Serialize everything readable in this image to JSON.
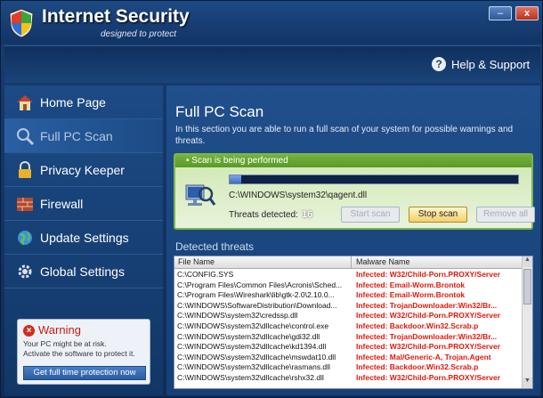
{
  "app": {
    "title": "Internet Security",
    "tagline": "designed to protect"
  },
  "window_controls": {
    "minimize": "–",
    "close": "x"
  },
  "helpbar": {
    "icon": "question-icon",
    "label": "Help & Support"
  },
  "sidebar": {
    "items": [
      {
        "label": "Home Page",
        "icon": "house-icon",
        "active": false
      },
      {
        "label": "Full PC Scan",
        "icon": "magnifier-icon",
        "active": true
      },
      {
        "label": "Privacy Keeper",
        "icon": "lock-icon",
        "active": false
      },
      {
        "label": "Firewall",
        "icon": "brick-wall-icon",
        "active": false
      },
      {
        "label": "Update Settings",
        "icon": "globe-icon",
        "active": false
      },
      {
        "label": "Global Settings",
        "icon": "gear-icon",
        "active": false
      }
    ],
    "warning": {
      "title": "Warning",
      "text": "Your PC might be at risk.\nActivate the software to protect it.",
      "button": "Get full time protection now"
    }
  },
  "main": {
    "title": "Full PC Scan",
    "description": "In this section you are able to run a full scan of your system for possible warnings and threats.",
    "scan": {
      "status": "Scan is being performed",
      "current_file": "C:\\WINDOWS\\system32\\qagent.dll",
      "progress": 0.04,
      "threats_label": "Threats detected:",
      "threats_count": "16",
      "buttons": {
        "start": "Start scan",
        "stop": "Stop scan",
        "remove": "Remove all"
      }
    },
    "detected_label": "Detected threats",
    "table": {
      "columns": [
        "File Name",
        "Malware Name"
      ],
      "rows": [
        [
          "C:\\CONFIG.SYS",
          "Infected: W32/Child-Porn.PROXY/Server"
        ],
        [
          "C:\\Program Files\\Common Files\\Acronis\\Sched...",
          "Infected: Email-Worm.Brontok"
        ],
        [
          "C:\\Program Files\\Wireshark\\lib\\gtk-2.0\\2.10.0...",
          "Infected: Email-Worm.Brontok"
        ],
        [
          "C:\\WINDOWS\\SoftwareDistribution\\Download...",
          "Infected: TrojanDownloader:Win32/Br..."
        ],
        [
          "C:\\WINDOWS\\system32\\credssp.dll",
          "Infected: W32/Child-Porn.PROXY/Server"
        ],
        [
          "C:\\WINDOWS\\system32\\dllcache\\control.exe",
          "Infected: Backdoor.Win32.Scrab.p"
        ],
        [
          "C:\\WINDOWS\\system32\\dllcache\\gdi32.dll",
          "Infected: TrojanDownloader:Win32/Br..."
        ],
        [
          "C:\\WINDOWS\\system32\\dllcache\\kd1394.dll",
          "Infected: W32/Child-Porn.PROXY/Server"
        ],
        [
          "C:\\WINDOWS\\system32\\dllcache\\mswdat10.dll",
          "Infected: Mal/Generic-A, Trojan.Agent"
        ],
        [
          "C:\\WINDOWS\\system32\\dllcache\\rasmans.dll",
          "Infected: Backdoor.Win32.Scrab.p"
        ],
        [
          "C:\\WINDOWS\\system32\\dllcache\\rshx32.dll",
          "Infected: W32/Child-Porn.PROXY/Server"
        ]
      ]
    }
  },
  "colors": {
    "accent_blue": "#1c4a85",
    "infected_red": "#e0170a",
    "scan_green": "#7cb64a"
  }
}
